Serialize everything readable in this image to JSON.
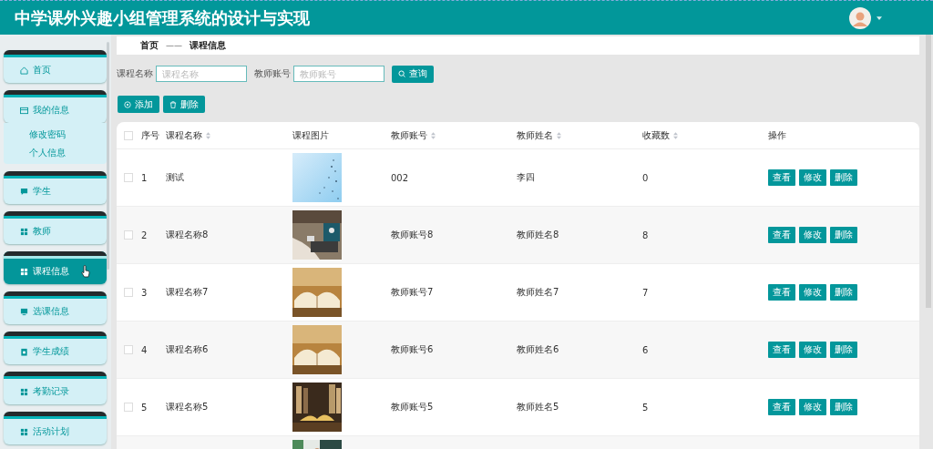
{
  "header": {
    "title": "中学课外兴趣小组管理系统的设计与实现"
  },
  "sidebar": {
    "items": [
      {
        "label": "首页",
        "selected": false
      },
      {
        "label": "我的信息",
        "selected": false,
        "expanded": true,
        "children": [
          {
            "label": "修改密码"
          },
          {
            "label": "个人信息"
          }
        ]
      },
      {
        "label": "学生",
        "selected": false
      },
      {
        "label": "教师",
        "selected": false
      },
      {
        "label": "课程信息",
        "selected": true
      },
      {
        "label": "选课信息",
        "selected": false
      },
      {
        "label": "学生成绩",
        "selected": false
      },
      {
        "label": "考勤记录",
        "selected": false
      },
      {
        "label": "活动计划",
        "selected": false
      }
    ]
  },
  "breadcrumb": {
    "home": "首页",
    "separator": "——",
    "current": "课程信息"
  },
  "search": {
    "fields": [
      {
        "label": "课程名称",
        "placeholder": "课程名称"
      },
      {
        "label": "教师账号",
        "placeholder": "教师账号"
      }
    ],
    "button": "查询"
  },
  "actions": [
    {
      "kind": "add",
      "label": "添加"
    },
    {
      "kind": "delete",
      "label": "删除"
    }
  ],
  "table": {
    "select_all": {
      "checked": false
    },
    "columns": [
      {
        "label": "序号",
        "sortable": false
      },
      {
        "label": "课程名称",
        "sortable": true
      },
      {
        "label": "课程图片",
        "sortable": false
      },
      {
        "label": "教师账号",
        "sortable": true
      },
      {
        "label": "教师姓名",
        "sortable": true
      },
      {
        "label": "收藏数",
        "sortable": true
      },
      {
        "label": "操作",
        "sortable": false
      }
    ],
    "rows": [
      {
        "checked": false,
        "cells": [
          "1",
          "测试",
          "002",
          "李四",
          "0"
        ],
        "image": {
          "kind": "picture"
        },
        "buttons": [
          "查看",
          "修改",
          "删除"
        ]
      },
      {
        "checked": false,
        "cells": [
          "2",
          "课程名称8",
          "教师账号8",
          "教师姓名8",
          "8"
        ],
        "image": {
          "kind": "picture"
        },
        "buttons": [
          "查看",
          "修改",
          "删除"
        ]
      },
      {
        "checked": false,
        "cells": [
          "3",
          "课程名称7",
          "教师账号7",
          "教师姓名7",
          "7"
        ],
        "image": {
          "kind": "picture"
        },
        "buttons": [
          "查看",
          "修改",
          "删除"
        ]
      },
      {
        "checked": false,
        "cells": [
          "4",
          "课程名称6",
          "教师账号6",
          "教师姓名6",
          "6"
        ],
        "image": {
          "kind": "picture"
        },
        "buttons": [
          "查看",
          "修改",
          "删除"
        ]
      },
      {
        "checked": false,
        "cells": [
          "5",
          "课程名称5",
          "教师账号5",
          "教师姓名5",
          "5"
        ],
        "image": {
          "kind": "picture"
        },
        "buttons": [
          "查看",
          "修改",
          "删除"
        ]
      },
      {
        "image": {
          "kind": "picture"
        }
      }
    ]
  }
}
